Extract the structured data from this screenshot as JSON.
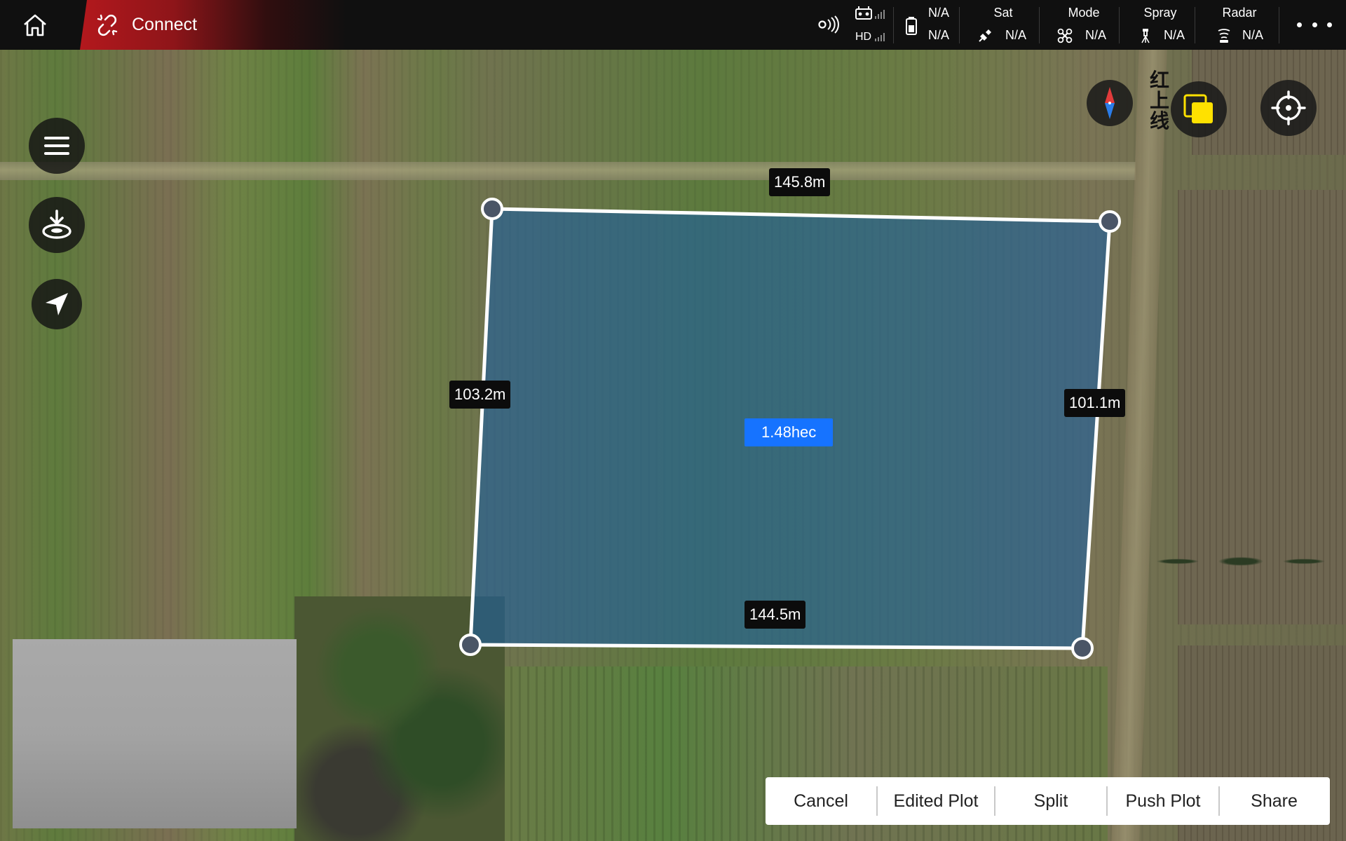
{
  "topbar": {
    "connect_label": "Connect",
    "signal": {
      "hd_label": "HD"
    },
    "battery": {
      "value_top": "N/A",
      "value_bottom": "N/A"
    },
    "sat": {
      "title": "Sat",
      "value": "N/A"
    },
    "mode": {
      "title": "Mode",
      "value": "N/A"
    },
    "spray": {
      "title": "Spray",
      "value": "N/A"
    },
    "radar": {
      "title": "Radar",
      "value": "N/A"
    }
  },
  "map": {
    "redline_label": "红上线",
    "plot": {
      "edges": {
        "top": "145.8m",
        "left": "103.2m",
        "right": "101.1m",
        "bottom": "144.5m"
      },
      "area": "1.48hec",
      "fill_color": "#1f5f9c",
      "stroke_color": "#ffffff"
    }
  },
  "actions": {
    "cancel": "Cancel",
    "edited_plot": "Edited Plot",
    "split": "Split",
    "push_plot": "Push Plot",
    "share": "Share"
  },
  "colors": {
    "accent_red": "#b3181d",
    "area_blue": "#1673ff",
    "bar_bg": "#101010"
  }
}
